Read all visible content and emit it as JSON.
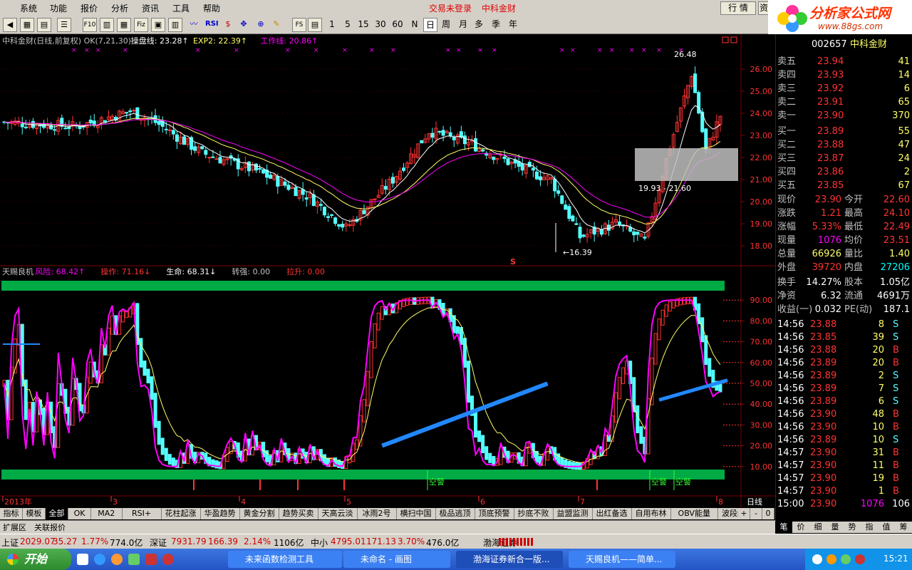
{
  "menu": {
    "items": [
      "系统",
      "功能",
      "报价",
      "分析",
      "资讯",
      "工具",
      "帮助"
    ],
    "trade_status": "交易未登录",
    "stock_name": "中科金财",
    "quote_button": "行 情",
    "info_button": "资"
  },
  "toolbar": {
    "fs_label": "FS",
    "periods": [
      "1",
      "5",
      "15",
      "30",
      "60",
      "N"
    ],
    "cycles": [
      "日",
      "周",
      "月",
      "多",
      "季",
      "年"
    ],
    "rsi_label": "RSI",
    "f10_label": "F10",
    "ftv_label": "Fiz"
  },
  "logo": {
    "title": "分析家公式网",
    "url": "www.88gs.com"
  },
  "top_panel": {
    "header": [
      {
        "text": "中科金财(日线,前复权) OK(7,21,30)",
        "color": "#c0c0c0"
      },
      {
        "text": "操盘线: 23.28↑",
        "color": "#ffffff"
      },
      {
        "text": "EXP2: 22.39↑",
        "color": "#ffff66"
      },
      {
        "text": "工作线: 20.86↑",
        "color": "#ff00ff"
      }
    ],
    "price_labels": [
      "26.00",
      "25.00",
      "24.00",
      "23.00",
      "22.00",
      "21.00",
      "20.00",
      "19.00",
      "18.00"
    ],
    "high_label": "26.48",
    "low_label": "16.39",
    "box_label": "19.93 - 21.60",
    "mark_s": "S"
  },
  "bottom_panel": {
    "header": [
      {
        "text": "天赐良机",
        "color": "#c0c0c0"
      },
      {
        "text": "风险: 68.42↑",
        "color": "#ff00ff"
      },
      {
        "text": "操作: 71.16↓",
        "color": "#ff3333"
      },
      {
        "text": "生命: 68.31↓",
        "color": "#ffffff"
      },
      {
        "text": "转强: 0.00",
        "color": "#c0c0c0"
      },
      {
        "text": "拉升: 0.00",
        "color": "#ff3333"
      }
    ],
    "scale_labels": [
      "90.00",
      "80.00",
      "70.00",
      "60.00",
      "50.00",
      "40.00",
      "30.00",
      "20.00",
      "10.00"
    ],
    "alerts": [
      "空警",
      "空警",
      "空警"
    ]
  },
  "x_axis": {
    "labels": [
      "2013年",
      "3",
      "4",
      "5",
      "6",
      "7",
      "8"
    ],
    "period_label": "日线"
  },
  "chart_data": {
    "type": "candlestick",
    "title": "中科金财(日线,前复权)",
    "ylim": [
      17.0,
      27.0
    ],
    "lines": [
      "操盘线",
      "EXP2",
      "工作线"
    ],
    "last": {
      "close": 23.9,
      "操盘线": 23.28,
      "EXP2": 22.39,
      "工作线": 20.86
    },
    "high": 26.48,
    "low": 16.39,
    "indicator": {
      "name": "天赐良机",
      "ylim": [
        0,
        100
      ],
      "风险": 68.42,
      "操作": 71.16,
      "生命": 68.31,
      "转强": 0.0,
      "拉升": 0.0
    }
  },
  "quote": {
    "code": "002657",
    "name": "中科金财",
    "asks": [
      {
        "label": "卖五",
        "price": "23.94",
        "vol": "41"
      },
      {
        "label": "卖四",
        "price": "23.93",
        "vol": "14"
      },
      {
        "label": "卖三",
        "price": "23.92",
        "vol": "6"
      },
      {
        "label": "卖二",
        "price": "23.91",
        "vol": "65"
      },
      {
        "label": "卖一",
        "price": "23.90",
        "vol": "370"
      }
    ],
    "bids": [
      {
        "label": "买一",
        "price": "23.89",
        "vol": "55"
      },
      {
        "label": "买二",
        "price": "23.88",
        "vol": "47"
      },
      {
        "label": "买三",
        "price": "23.87",
        "vol": "24"
      },
      {
        "label": "买四",
        "price": "23.86",
        "vol": "2"
      },
      {
        "label": "买五",
        "price": "23.85",
        "vol": "67"
      }
    ],
    "stats": [
      {
        "l1": "现价",
        "v1": "23.90",
        "c1": "#ff3333",
        "l2": "今开",
        "v2": "22.60",
        "c2": "#ff3333"
      },
      {
        "l1": "涨跌",
        "v1": "1.21",
        "c1": "#ff3333",
        "l2": "最高",
        "v2": "24.10",
        "c2": "#ff3333"
      },
      {
        "l1": "涨幅",
        "v1": "5.33%",
        "c1": "#ff3333",
        "l2": "最低",
        "v2": "22.49",
        "c2": "#ff3333"
      },
      {
        "l1": "现量",
        "v1": "1076",
        "c1": "#ff00ff",
        "l2": "均价",
        "v2": "23.51",
        "c2": "#ff3333"
      },
      {
        "l1": "总量",
        "v1": "66926",
        "c1": "#ffff66",
        "l2": "量比",
        "v2": "1.40",
        "c2": "#ffff66"
      },
      {
        "l1": "外盘",
        "v1": "39720",
        "c1": "#ff3333",
        "l2": "内盘",
        "v2": "27206",
        "c2": "#00ffff"
      }
    ],
    "fund": [
      {
        "l1": "换手",
        "v1": "14.27%",
        "l2": "股本",
        "v2": "1.05亿"
      },
      {
        "l1": "净资",
        "v1": "6.32",
        "l2": "流通",
        "v2": "4691万"
      },
      {
        "l1": "收益(一)",
        "v1": "0.032",
        "l2": "PE(动)",
        "v2": "187.1"
      }
    ],
    "ticks": [
      {
        "time": "14:56",
        "price": "23.88",
        "vol": "8",
        "bs": "S"
      },
      {
        "time": "14:56",
        "price": "23.85",
        "vol": "39",
        "bs": "S"
      },
      {
        "time": "14:56",
        "price": "23.88",
        "vol": "20",
        "bs": "B"
      },
      {
        "time": "14:56",
        "price": "23.89",
        "vol": "20",
        "bs": "B"
      },
      {
        "time": "14:56",
        "price": "23.89",
        "vol": "2",
        "bs": "S"
      },
      {
        "time": "14:56",
        "price": "23.89",
        "vol": "7",
        "bs": "S"
      },
      {
        "time": "14:56",
        "price": "23.89",
        "vol": "6",
        "bs": "S"
      },
      {
        "time": "14:56",
        "price": "23.90",
        "vol": "48",
        "bs": "B"
      },
      {
        "time": "14:56",
        "price": "23.90",
        "vol": "10",
        "bs": "B"
      },
      {
        "time": "14:56",
        "price": "23.89",
        "vol": "10",
        "bs": "S"
      },
      {
        "time": "14:57",
        "price": "23.90",
        "vol": "31",
        "bs": "B"
      },
      {
        "time": "14:57",
        "price": "23.90",
        "vol": "11",
        "bs": "B"
      },
      {
        "time": "14:57",
        "price": "23.90",
        "vol": "19",
        "bs": "B"
      },
      {
        "time": "14:57",
        "price": "23.90",
        "vol": "1",
        "bs": "B"
      },
      {
        "time": "15:00",
        "price": "23.90",
        "vol": "1076",
        "bs": "B"
      }
    ],
    "tick_last_right": "106"
  },
  "bottom_tabs": [
    "指标",
    "模板",
    "全部",
    "OK",
    "MA2",
    "RSI+",
    "花柱起涨",
    "华盈趋势",
    "黄金分割",
    "趋势买卖",
    "天高云淡",
    "冰雨2号",
    "横扫中国",
    "极品逃顶",
    "顶底预警",
    "抄底不败",
    "益盟监测",
    "出红备选",
    "自用布林",
    "OBV能量",
    "波段绝品"
  ],
  "bottom_tabs_right": [
    "+",
    "-",
    "0"
  ],
  "ext_tabs": [
    "扩展区",
    "关联报价"
  ],
  "right_tabs": [
    "笔",
    "价",
    "细",
    "量",
    "势",
    "指",
    "值",
    "筹"
  ],
  "status": [
    {
      "text": "上证",
      "color": "#000000"
    },
    {
      "text": "2029.07",
      "color": "#cc0000"
    },
    {
      "text": "35.27",
      "color": "#cc0000"
    },
    {
      "text": "1.77%",
      "color": "#cc0000"
    },
    {
      "text": "774.0亿",
      "color": "#000000"
    },
    {
      "text": "深证",
      "color": "#000000"
    },
    {
      "text": "7931.79",
      "color": "#cc0000"
    },
    {
      "text": "166.39",
      "color": "#cc0000"
    },
    {
      "text": "2.14%",
      "color": "#cc0000"
    },
    {
      "text": "1106亿",
      "color": "#000000"
    },
    {
      "text": "中小",
      "color": "#000000"
    },
    {
      "text": "4795.01",
      "color": "#cc0000"
    },
    {
      "text": "171.13",
      "color": "#cc0000"
    },
    {
      "text": "3.70%",
      "color": "#cc0000"
    },
    {
      "text": "476.0亿",
      "color": "#000000"
    },
    {
      "text": "渤海证券",
      "color": "#000000"
    }
  ],
  "taskbar": {
    "start": "开始",
    "tasks": [
      "未来函数检测工具",
      "未命名 - 画图",
      "渤海证券新合一版...",
      "天赐良机——简单..."
    ],
    "clock": "15:21"
  }
}
